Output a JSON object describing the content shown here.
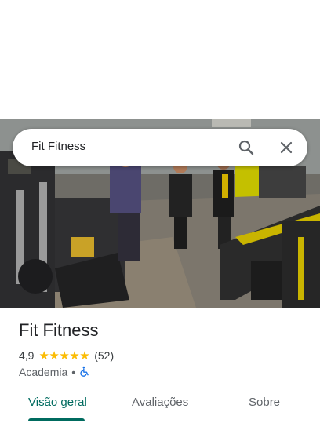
{
  "search": {
    "query": "Fit Fitness"
  },
  "place": {
    "name": "Fit Fitness",
    "rating": "4,9",
    "stars": "★★★★★",
    "review_count": "(52)",
    "category": "Academia",
    "separator": "•"
  },
  "tabs": [
    {
      "label": "Visão geral",
      "active": true
    },
    {
      "label": "Avaliações",
      "active": false
    },
    {
      "label": "Sobre",
      "active": false
    }
  ],
  "colors": {
    "accent": "#006b5f",
    "star": "#fbbc04",
    "accessibility": "#1a73e8"
  },
  "icons": [
    "search-icon",
    "close-icon",
    "wheelchair-icon"
  ]
}
